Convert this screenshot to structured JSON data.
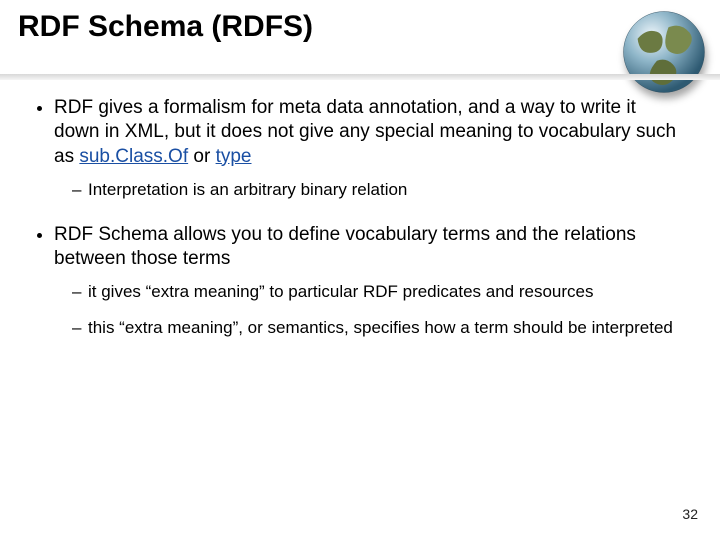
{
  "title": "RDF Schema (RDFS)",
  "bullets": {
    "b1_pre": "RDF gives a formalism for meta data annotation, and a way to write it down in XML, but it does not give any special meaning to vocabulary such as ",
    "b1_kw1": "sub.Class.Of",
    "b1_mid": " or ",
    "b1_kw2": "type",
    "b1_sub1": "Interpretation is an arbitrary binary relation",
    "b2": "RDF Schema allows you to define vocabulary terms and the relations between those terms",
    "b2_sub1": "it gives “extra meaning” to particular RDF predicates and resources",
    "b2_sub2": "this “extra meaning”, or semantics, specifies how a term should be interpreted"
  },
  "page_number": "32"
}
